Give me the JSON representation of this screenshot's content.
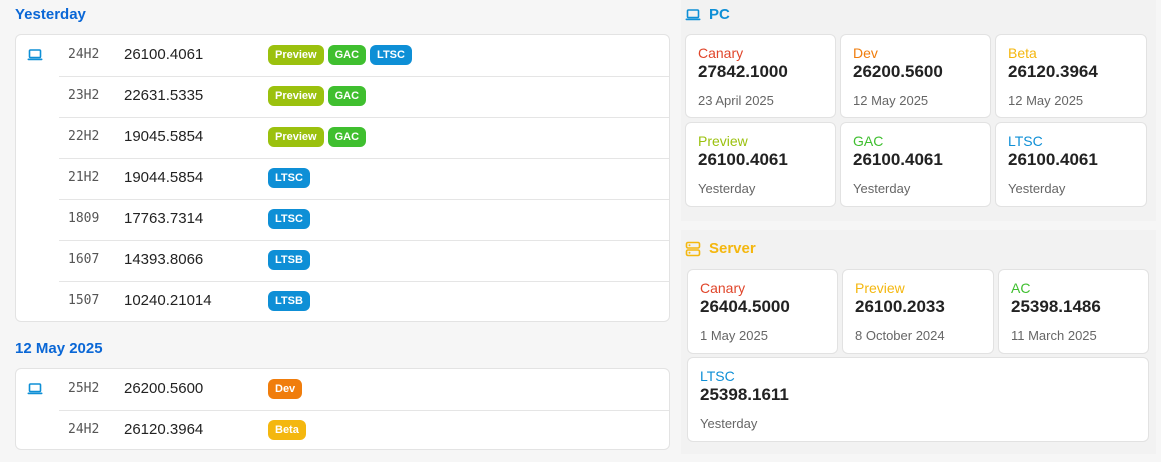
{
  "left": {
    "groups": [
      {
        "title": "Yesterday",
        "rows": [
          {
            "version": "24H2",
            "build": "26100.4061",
            "tags": [
              "Preview",
              "GAC",
              "LTSC"
            ],
            "icon": "laptop-icon"
          },
          {
            "version": "23H2",
            "build": "22631.5335",
            "tags": [
              "Preview",
              "GAC"
            ]
          },
          {
            "version": "22H2",
            "build": "19045.5854",
            "tags": [
              "Preview",
              "GAC"
            ]
          },
          {
            "version": "21H2",
            "build": "19044.5854",
            "tags": [
              "LTSC"
            ]
          },
          {
            "version": "1809",
            "build": "17763.7314",
            "tags": [
              "LTSC"
            ]
          },
          {
            "version": "1607",
            "build": "14393.8066",
            "tags": [
              "LTSB"
            ]
          },
          {
            "version": "1507",
            "build": "10240.21014",
            "tags": [
              "LTSB"
            ]
          }
        ]
      },
      {
        "title": "12 May 2025",
        "rows": [
          {
            "version": "25H2",
            "build": "26200.5600",
            "tags": [
              "Dev"
            ],
            "icon": "laptop-icon"
          },
          {
            "version": "24H2",
            "build": "26120.3964",
            "tags": [
              "Beta"
            ]
          }
        ]
      }
    ]
  },
  "tag_colors": {
    "Preview": "#9bc10e",
    "GAC": "#3fbf2f",
    "LTSC": "#0e8fd6",
    "LTSB": "#0e8fd6",
    "Dev": "#f07d0c",
    "Beta": "#f4b70f"
  },
  "pc": {
    "title": "PC",
    "icon": "laptop-icon",
    "color": "#0e8fd6",
    "tiles": [
      {
        "name": "Canary",
        "build": "27842.1000",
        "date": "23 April 2025",
        "color": "#e0452a"
      },
      {
        "name": "Dev",
        "build": "26200.5600",
        "date": "12 May 2025",
        "color": "#f07d0c"
      },
      {
        "name": "Beta",
        "build": "26120.3964",
        "date": "12 May 2025",
        "color": "#f4b70f"
      },
      {
        "name": "Preview",
        "build": "26100.4061",
        "date": "Yesterday",
        "color": "#9bc10e"
      },
      {
        "name": "GAC",
        "build": "26100.4061",
        "date": "Yesterday",
        "color": "#3fbf2f"
      },
      {
        "name": "LTSC",
        "build": "26100.4061",
        "date": "Yesterday",
        "color": "#0e8fd6"
      }
    ]
  },
  "server": {
    "title": "Server",
    "icon": "server-icon",
    "color": "#f4b70f",
    "tiles": [
      {
        "name": "Canary",
        "build": "26404.5000",
        "date": "1 May 2025",
        "color": "#e0452a"
      },
      {
        "name": "Preview",
        "build": "26100.2033",
        "date": "8 October 2024",
        "color": "#f4b70f"
      },
      {
        "name": "AC",
        "build": "25398.1486",
        "date": "11 March 2025",
        "color": "#3fbf2f"
      },
      {
        "name": "LTSC",
        "build": "25398.1611",
        "date": "Yesterday",
        "color": "#0e8fd6"
      }
    ]
  }
}
